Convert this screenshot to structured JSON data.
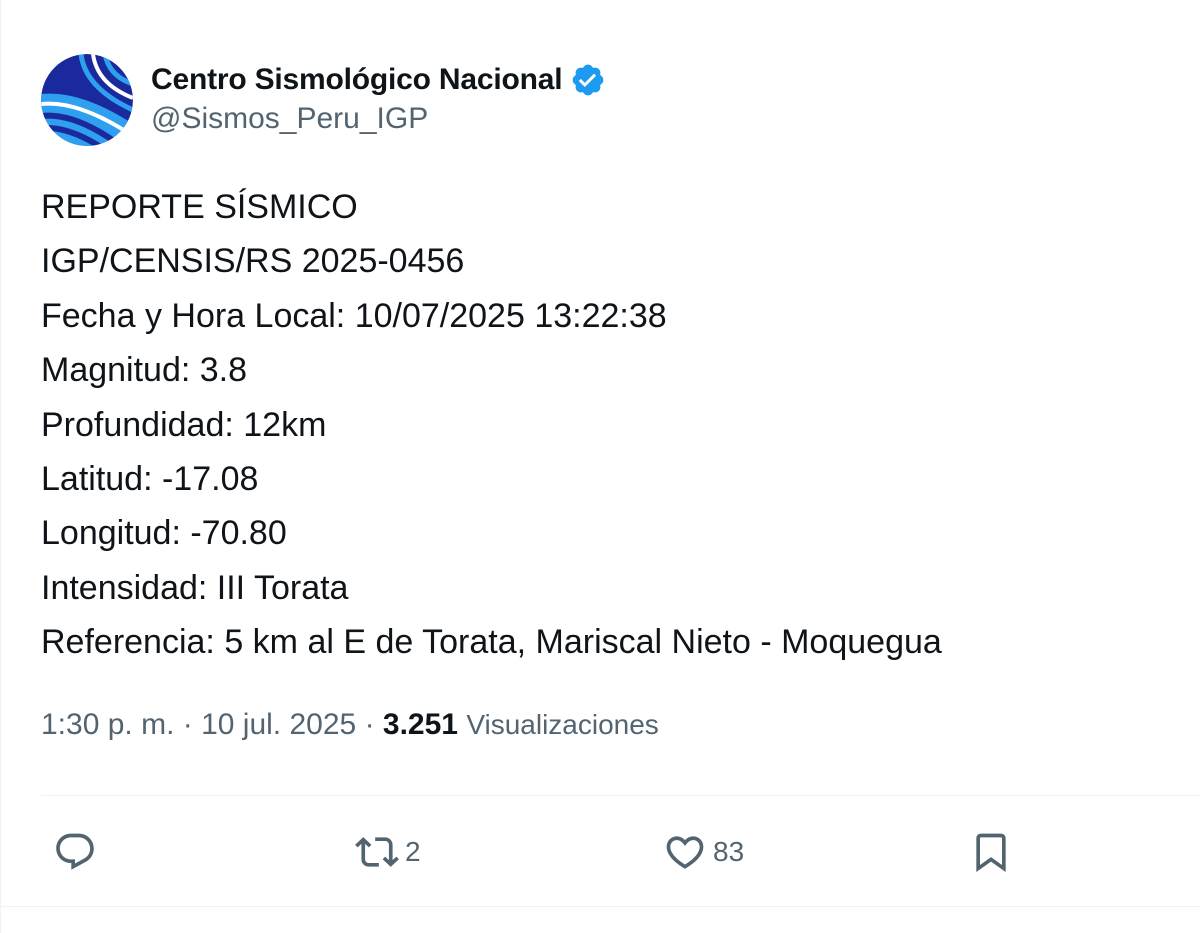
{
  "author": {
    "display_name": "Centro Sismológico Nacional",
    "handle": "@Sismos_Peru_IGP",
    "verified": true,
    "avatar_icon": "igp-seismic-logo-icon"
  },
  "tweet": {
    "lines": [
      "REPORTE SÍSMICO",
      "IGP/CENSIS/RS 2025-0456",
      "Fecha y Hora Local: 10/07/2025 13:22:38",
      "Magnitud: 3.8",
      "Profundidad: 12km",
      "Latitud: -17.08",
      "Longitud: -70.80",
      "Intensidad: III Torata",
      "Referencia: 5 km al E de Torata, Mariscal Nieto - Moquegua"
    ]
  },
  "meta": {
    "time": "1:30 p. m.",
    "separator": "·",
    "date": "10 jul. 2025",
    "views_count": "3.251",
    "views_label": "Visualizaciones"
  },
  "actions": {
    "reply": {
      "icon": "reply-icon",
      "count": ""
    },
    "retweet": {
      "icon": "retweet-icon",
      "count": "2"
    },
    "like": {
      "icon": "heart-icon",
      "count": "83"
    },
    "bookmark": {
      "icon": "bookmark-icon",
      "count": ""
    }
  },
  "colors": {
    "text_primary": "#0f1419",
    "text_secondary": "#536471",
    "verified_blue": "#1d9bf0",
    "divider": "#eff3f4",
    "logo_dark_blue": "#1a2a9c",
    "logo_light_blue": "#2fa0f0"
  }
}
